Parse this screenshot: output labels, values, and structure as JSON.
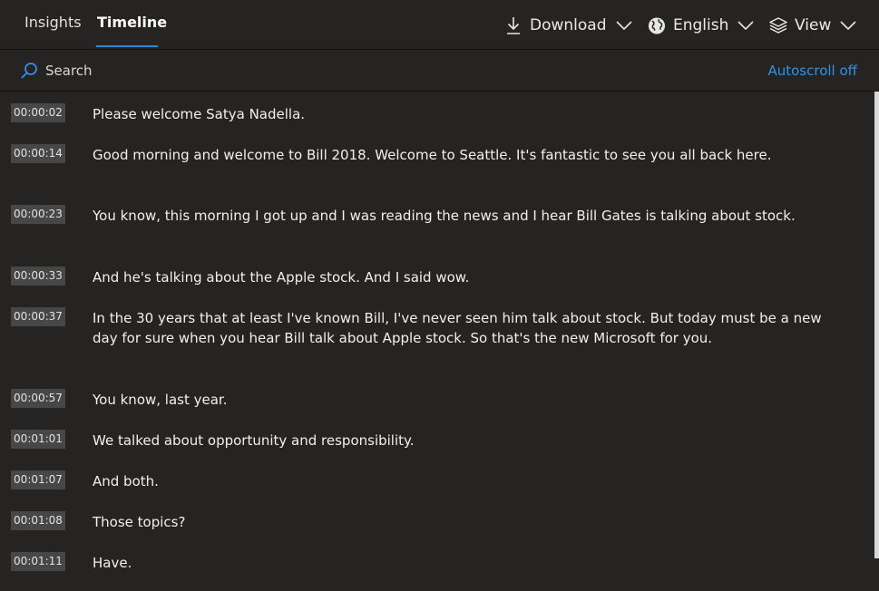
{
  "tabs": [
    {
      "label": "Insights",
      "active": false
    },
    {
      "label": "Timeline",
      "active": true
    }
  ],
  "toolbar": {
    "download_label": "Download",
    "language_label": "English",
    "view_label": "View"
  },
  "search": {
    "label": "Search"
  },
  "autoscroll_label": "Autoscroll off",
  "colors": {
    "accent": "#2b88d8",
    "link": "#2f93e8",
    "background": "#252423",
    "timestamp_bg": "#474747"
  },
  "transcript": [
    {
      "time": "00:00:02",
      "text": "Please welcome Satya Nadella."
    },
    {
      "time": "00:00:14",
      "text": "Good morning and welcome to Bill 2018. Welcome to Seattle. It's fantastic to see you all back here."
    },
    {
      "time": "00:00:23",
      "text": "You know, this morning I got up and I was reading the news and I hear Bill Gates is talking about stock."
    },
    {
      "time": "00:00:33",
      "text": "And he's talking about the Apple stock. And I said wow."
    },
    {
      "time": "00:00:37",
      "text": "In the 30 years that at least I've known Bill, I've never seen him talk about stock. But today must be a new day for sure when you hear Bill talk about Apple stock. So that's the new Microsoft for you."
    },
    {
      "time": "00:00:57",
      "text": "You know, last year."
    },
    {
      "time": "00:01:01",
      "text": "We talked about opportunity and responsibility."
    },
    {
      "time": "00:01:07",
      "text": "And both."
    },
    {
      "time": "00:01:08",
      "text": "Those topics?"
    },
    {
      "time": "00:01:11",
      "text": "Have."
    }
  ]
}
